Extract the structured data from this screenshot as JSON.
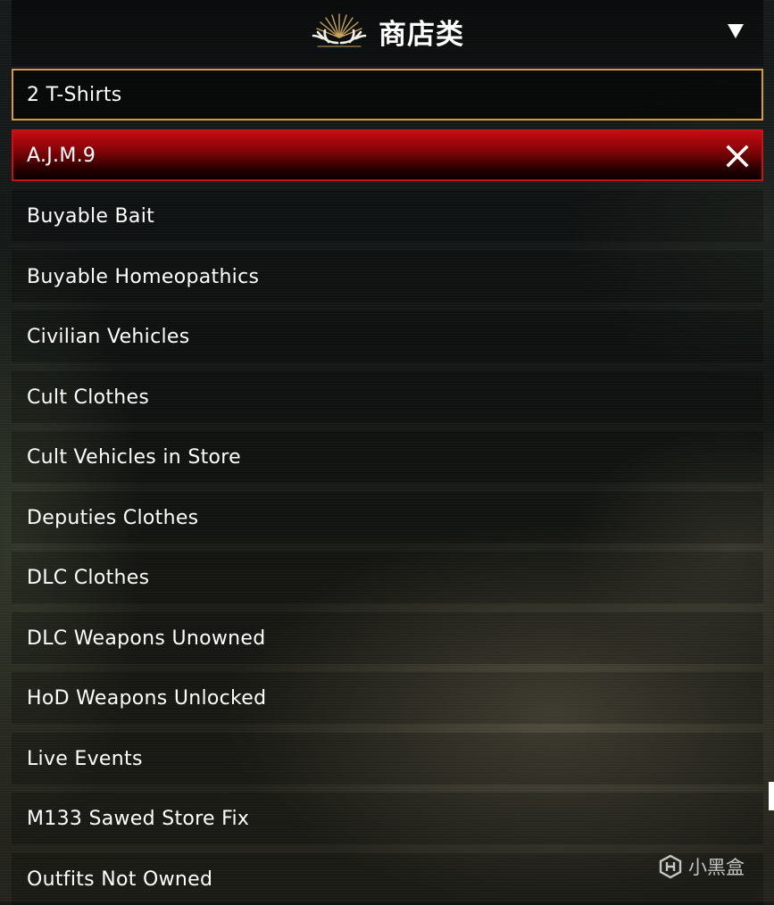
{
  "header": {
    "title": "商店类",
    "emblem_icon": "antler-emblem-icon",
    "dropdown_icon": "triangle-down-icon"
  },
  "list": {
    "items": [
      {
        "label": "2 T-Shirts",
        "state": "active"
      },
      {
        "label": "A.J.M.9",
        "state": "selected",
        "action_icon": "close-icon"
      },
      {
        "label": "Buyable Bait",
        "state": "normal"
      },
      {
        "label": "Buyable Homeopathics",
        "state": "normal"
      },
      {
        "label": "Civilian Vehicles",
        "state": "normal"
      },
      {
        "label": "Cult Clothes",
        "state": "normal"
      },
      {
        "label": "Cult Vehicles in Store",
        "state": "normal"
      },
      {
        "label": "Deputies Clothes",
        "state": "normal"
      },
      {
        "label": "DLC Clothes",
        "state": "normal"
      },
      {
        "label": "DLC Weapons Unowned",
        "state": "normal"
      },
      {
        "label": "HoD Weapons Unlocked",
        "state": "normal"
      },
      {
        "label": "Live Events",
        "state": "normal"
      },
      {
        "label": "M133 Sawed Store Fix",
        "state": "normal"
      },
      {
        "label": "Outfits Not Owned",
        "state": "normal"
      }
    ]
  },
  "watermark": {
    "text": "小黑盒",
    "icon": "heybox-logo-icon"
  },
  "colors": {
    "active_border": "#d99a3a",
    "selected_red": "#c8121a",
    "emblem_gold": "#c9a35a"
  }
}
